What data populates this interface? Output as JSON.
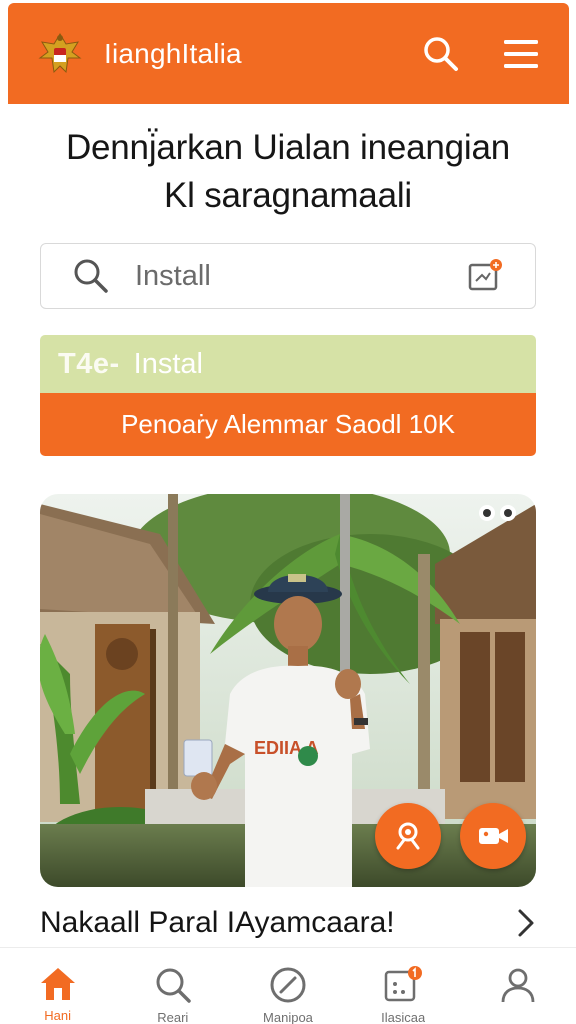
{
  "header": {
    "title": "IianghItalia",
    "search_icon": "search-icon",
    "menu_icon": "hamburger-menu-icon"
  },
  "hero": {
    "line1": "Dennj̈arkan Uialan ineangian",
    "line2": "Kl saragnamaali"
  },
  "search": {
    "placeholder": "Install",
    "scan_icon": "scan-icon"
  },
  "banner": {
    "lead": "T4e-",
    "text": "Instal",
    "action_label": "Penoaṙy Alemmar Saodl 10K"
  },
  "photo": {
    "shirt_text": "EDIIA A",
    "actions": [
      "person-badge-icon",
      "video-icon"
    ]
  },
  "caption": {
    "text": "Nakaall Paral IAyamcaara!"
  },
  "bottom_nav": [
    {
      "label": "Hani",
      "icon": "home-icon",
      "active": true
    },
    {
      "label": "Reari",
      "icon": "search-icon",
      "active": false
    },
    {
      "label": "Manipoa",
      "icon": "compass-icon",
      "active": false
    },
    {
      "label": "Ilasicaa",
      "icon": "grid-badge-icon",
      "active": false
    },
    {
      "label": "",
      "icon": "profile-icon",
      "active": false
    }
  ],
  "colors": {
    "accent": "#f26b22",
    "banner_light": "#d6e2a6",
    "text_dark": "#161616"
  }
}
